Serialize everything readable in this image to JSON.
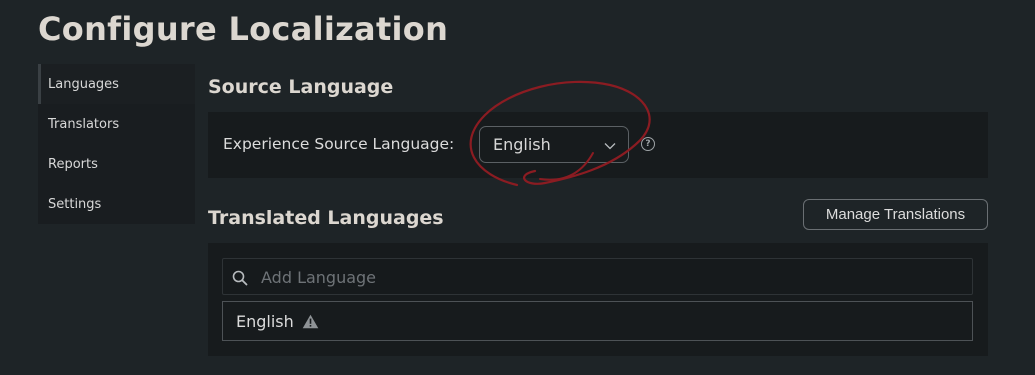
{
  "page": {
    "title": "Configure Localization"
  },
  "sidebar": {
    "items": [
      {
        "label": "Languages",
        "active": true
      },
      {
        "label": "Translators"
      },
      {
        "label": "Reports"
      },
      {
        "label": "Settings"
      }
    ]
  },
  "source_section": {
    "heading": "Source Language",
    "field_label": "Experience Source Language:",
    "selected_language": "English",
    "dropdown_icon": "chevron-down-icon",
    "help_icon": "question-circle-icon"
  },
  "translated_section": {
    "heading": "Translated Languages",
    "manage_button_label": "Manage Translations",
    "search": {
      "placeholder": "Add Language",
      "icon": "search-icon"
    },
    "languages": [
      {
        "name": "English",
        "status_icon": "warning-icon"
      }
    ]
  },
  "annotation": {
    "color": "#8b1c22"
  }
}
